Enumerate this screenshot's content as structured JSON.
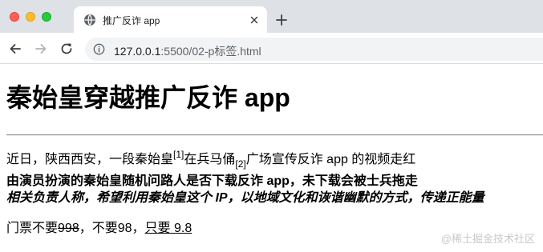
{
  "browser": {
    "tab_title": "推广反诈 app",
    "url_host": "127.0.0.1",
    "url_path": ":5500/02-p标签.html"
  },
  "page": {
    "heading": "秦始皇穿越推广反诈 app",
    "para1": {
      "part1": "近日，陕西西安，一段秦始皇",
      "sup": "[1]",
      "part2": "在兵马俑",
      "sub": "[2]",
      "part3": "广场宣传反诈 app 的视频走红"
    },
    "para2": "由演员扮演的秦始皇随机问路人是否下载反诈 app，未下载会被士兵拖走",
    "para3": "相关负责人称，希望利用秦始皇这个 IP，以地域文化和诙谐幽默的方式，传递正能量",
    "para4": {
      "prefix": "门票不要",
      "struck_price": "998",
      "middle": "，不要98，",
      "underlined": "只要 9.8"
    },
    "watermark": "@稀土掘金技术社区"
  },
  "colors": {
    "tabstrip_bg": "#dee1e6",
    "omnibox_bg": "#f1f3f4",
    "close_red": "#ff5f57",
    "minimize_yellow": "#febc2e",
    "zoom_green": "#28c840"
  }
}
